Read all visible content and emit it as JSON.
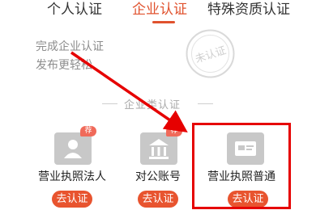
{
  "tabs": [
    {
      "label": "个人认证",
      "active": false
    },
    {
      "label": "企业认证",
      "active": true
    },
    {
      "label": "特殊资质认证",
      "active": false
    }
  ],
  "promo": {
    "line1": "完成企业认证",
    "line2": "发布更轻松",
    "stamp_text": "未认证"
  },
  "section_title": "企业类认证",
  "cards": [
    {
      "name": "营业执照法人",
      "badge": "荐",
      "button": "去认证",
      "icon": "person-id-icon"
    },
    {
      "name": "对公账号",
      "badge": "荐",
      "button": "去认证",
      "icon": "bank-icon"
    },
    {
      "name": "营业执照普通",
      "badge": "",
      "button": "去认证",
      "icon": "license-card-icon"
    }
  ],
  "colors": {
    "accent": "#e0522e",
    "button": "#e8542f",
    "badge": "#f06a5a",
    "highlight": "#e60000"
  }
}
